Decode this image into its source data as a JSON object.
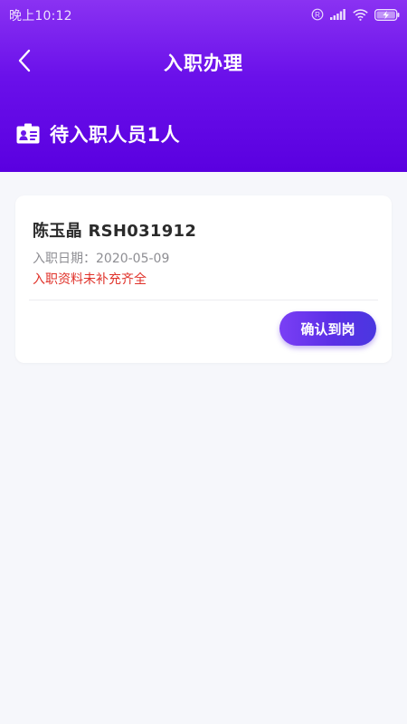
{
  "status_bar": {
    "time": "晚上10:12",
    "icons": [
      "registered-icon",
      "signal-icon",
      "wifi-icon",
      "battery-charging-icon"
    ]
  },
  "nav": {
    "title": "入职办理",
    "back_icon": "chevron-left-icon"
  },
  "pending": {
    "icon": "id-card-icon",
    "text": "待入职人员1人"
  },
  "employees": [
    {
      "name_id": "陈玉晶 RSH031912",
      "date_text": "入职日期：2020-05-09",
      "warning": "入职资料未补充齐全",
      "action_label": "确认到岗"
    }
  ],
  "colors": {
    "header_gradient_top": "#8a32f2",
    "header_gradient_bottom": "#5a00e0",
    "warning": "#e0322a",
    "button_start": "#7a3ff5",
    "button_end": "#4a37e0",
    "background": "#f6f7fb"
  }
}
